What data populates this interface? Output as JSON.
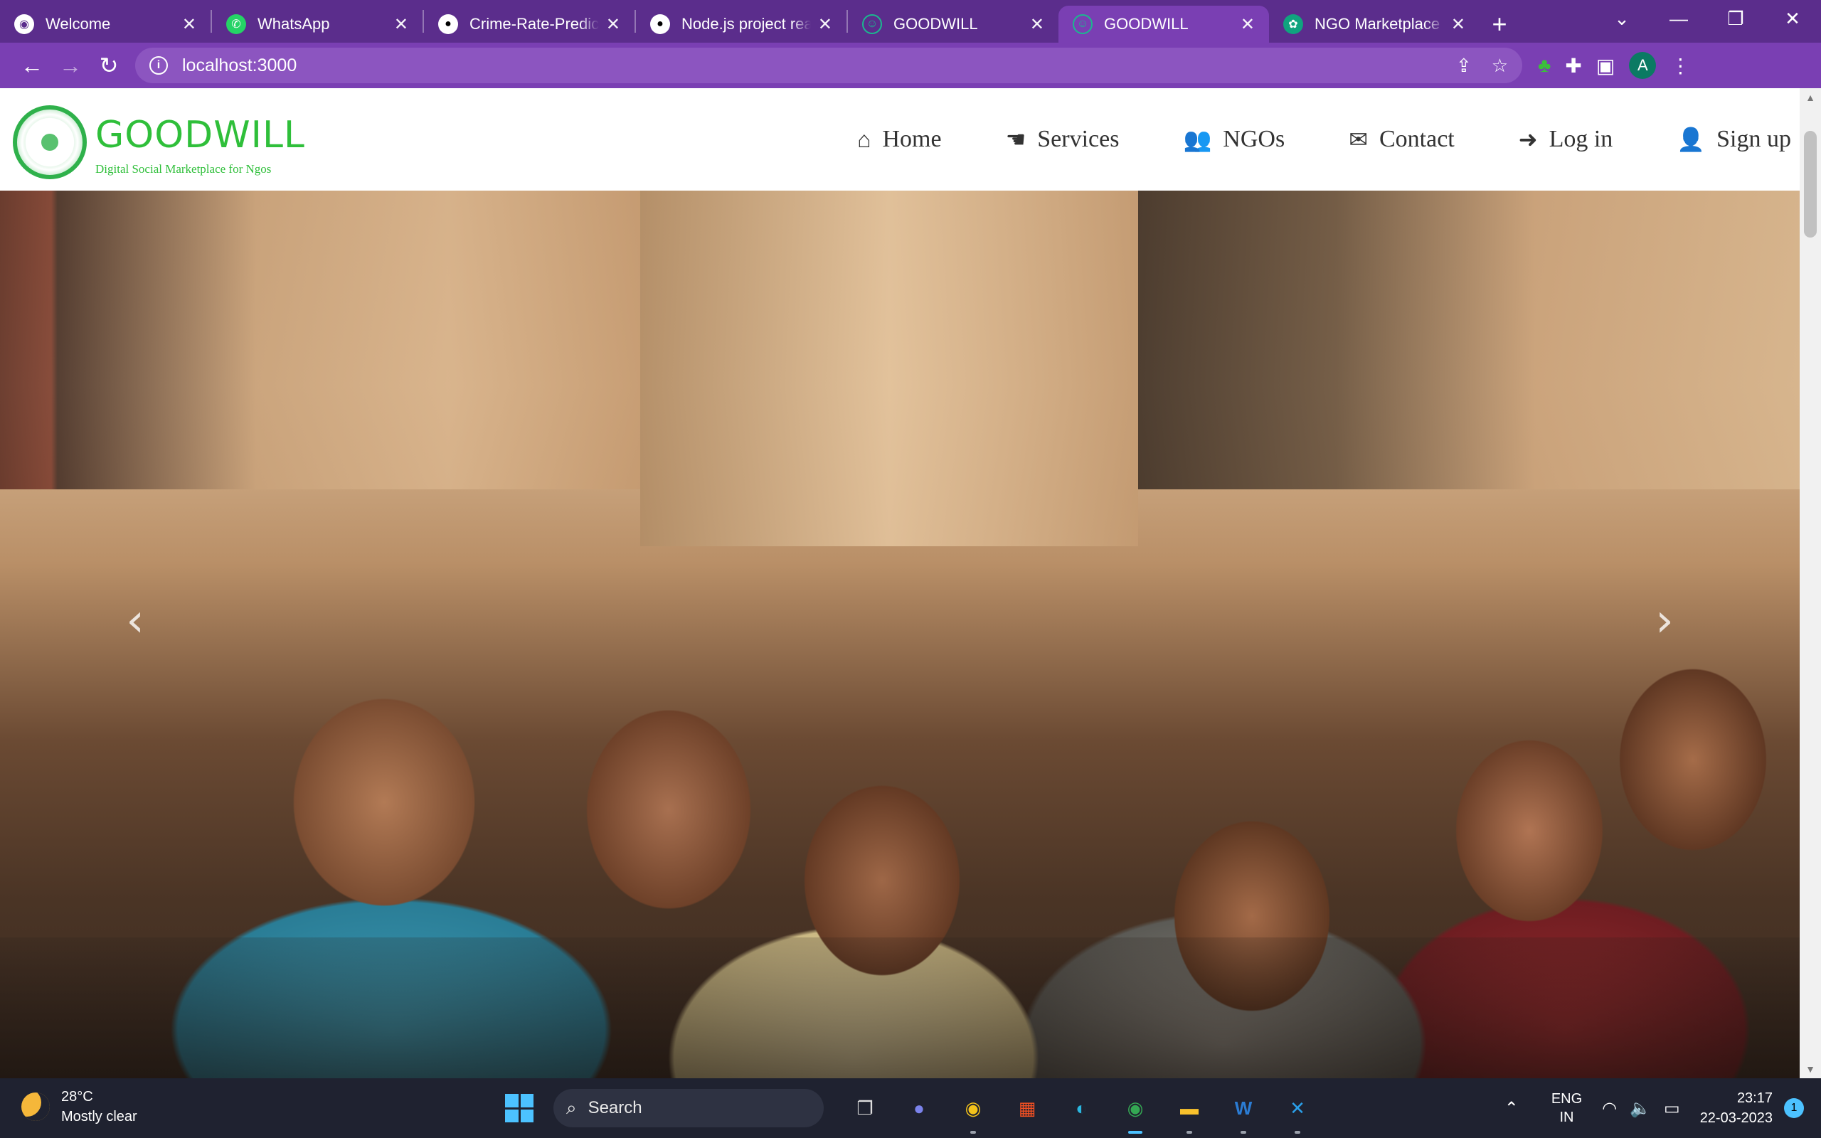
{
  "browser": {
    "tabs": [
      {
        "title": "Welcome",
        "favicon": "globe-icon",
        "color": "#ffffff"
      },
      {
        "title": "WhatsApp",
        "favicon": "whatsapp-icon",
        "color": "#25d366"
      },
      {
        "title": "Crime-Rate-Predicti",
        "favicon": "github-icon",
        "color": "#ffffff"
      },
      {
        "title": "Node.js project reac",
        "favicon": "github-icon",
        "color": "#ffffff"
      },
      {
        "title": "GOODWILL",
        "favicon": "goodwill-icon",
        "color": "#0b7a63"
      },
      {
        "title": "GOODWILL",
        "favicon": "goodwill-icon",
        "color": "#0b7a63"
      },
      {
        "title": "NGO Marketplace W",
        "favicon": "chatgpt-icon",
        "color": "#10a37f"
      }
    ],
    "active_tab": 5,
    "url": "localhost:3000",
    "profile_initial": "A"
  },
  "site": {
    "brand": "GOODWILL",
    "tagline": "Digital Social Marketplace for Ngos",
    "nav": [
      {
        "label": "Home",
        "icon": "home-icon",
        "glyph": "⌂"
      },
      {
        "label": "Services",
        "icon": "handshake-icon",
        "glyph": "☚"
      },
      {
        "label": "NGOs",
        "icon": "users-icon",
        "glyph": "👥"
      },
      {
        "label": "Contact",
        "icon": "envelope-icon",
        "glyph": "✉"
      },
      {
        "label": "Log in",
        "icon": "sign-in-icon",
        "glyph": "➜"
      },
      {
        "label": "Sign up",
        "icon": "user-plus-icon",
        "glyph": "👤"
      }
    ],
    "hero": {
      "alt": "children-sitting-together-photo"
    }
  },
  "taskbar": {
    "weather": {
      "temp": "28°C",
      "desc": "Mostly clear"
    },
    "search_label": "Search",
    "lang_line1": "ENG",
    "lang_line2": "IN",
    "time": "23:17",
    "date": "22-03-2023",
    "notifications": "1"
  }
}
